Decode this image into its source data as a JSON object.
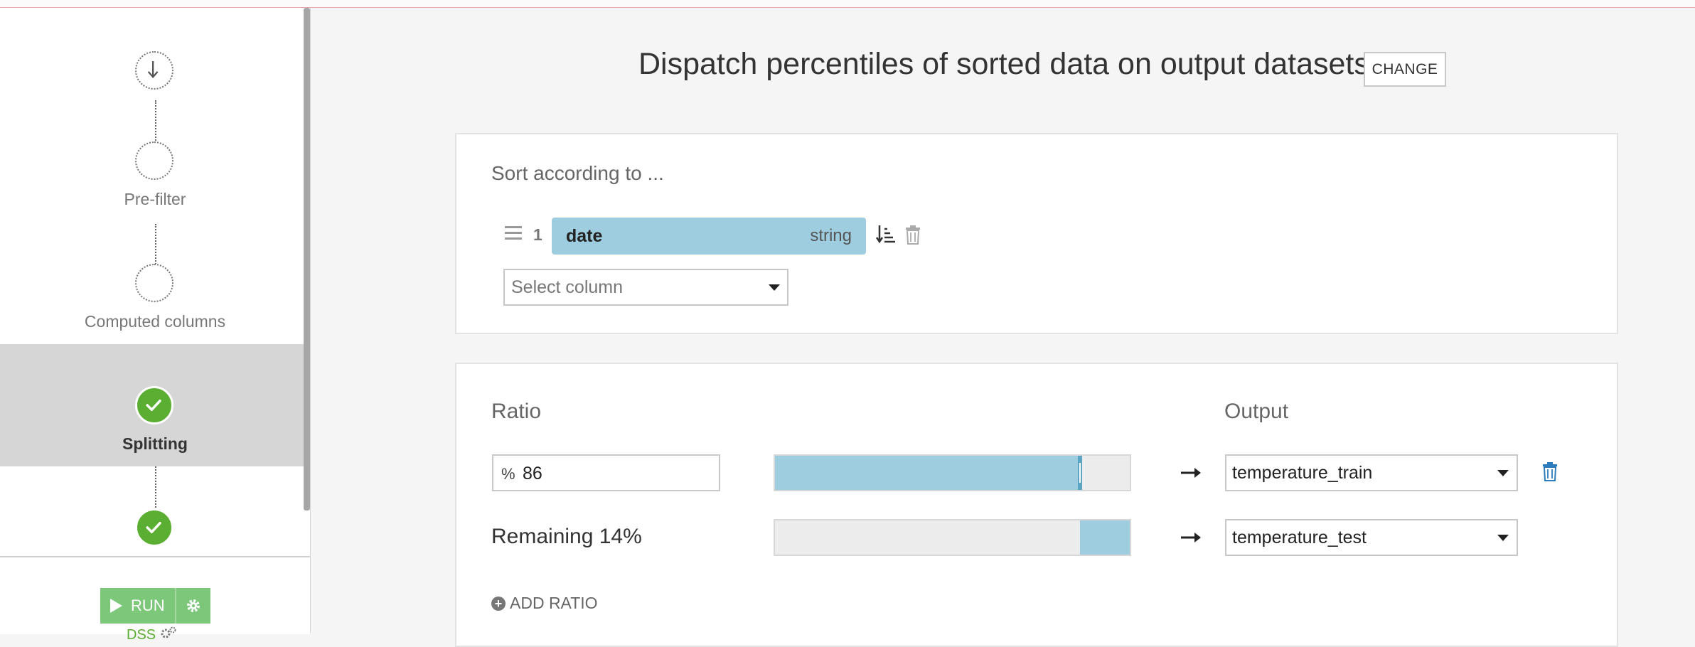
{
  "sidebar": {
    "steps": [
      {
        "label": "",
        "state": "pending",
        "icon": "arrow-down-icon"
      },
      {
        "label": "Pre-filter",
        "state": "pending"
      },
      {
        "label": "Computed columns",
        "state": "pending"
      },
      {
        "label": "Splitting",
        "state": "done",
        "active": true
      },
      {
        "label": "",
        "state": "done"
      }
    ],
    "run_label": "RUN",
    "engine_label": "DSS"
  },
  "header": {
    "title": "Dispatch percentiles of sorted data on output datasets",
    "change_label": "CHANGE"
  },
  "sort": {
    "title": "Sort according to ...",
    "columns": [
      {
        "index": "1",
        "name": "date",
        "type": "string"
      }
    ],
    "select_placeholder": "Select column"
  },
  "split": {
    "ratio_label": "Ratio",
    "output_label": "Output",
    "ratio_prefix": "%",
    "ratio_value": "86",
    "ratio_fraction": 0.86,
    "remaining_label": "Remaining 14%",
    "remaining_fraction": 0.14,
    "outputs": [
      "temperature_train",
      "temperature_test"
    ],
    "add_ratio_label": "ADD RATIO"
  },
  "colors": {
    "accent_blue": "#9fcde0",
    "success_green": "#5aae31",
    "run_green": "#7cc77a",
    "delete_blue": "#2b7bbd"
  }
}
